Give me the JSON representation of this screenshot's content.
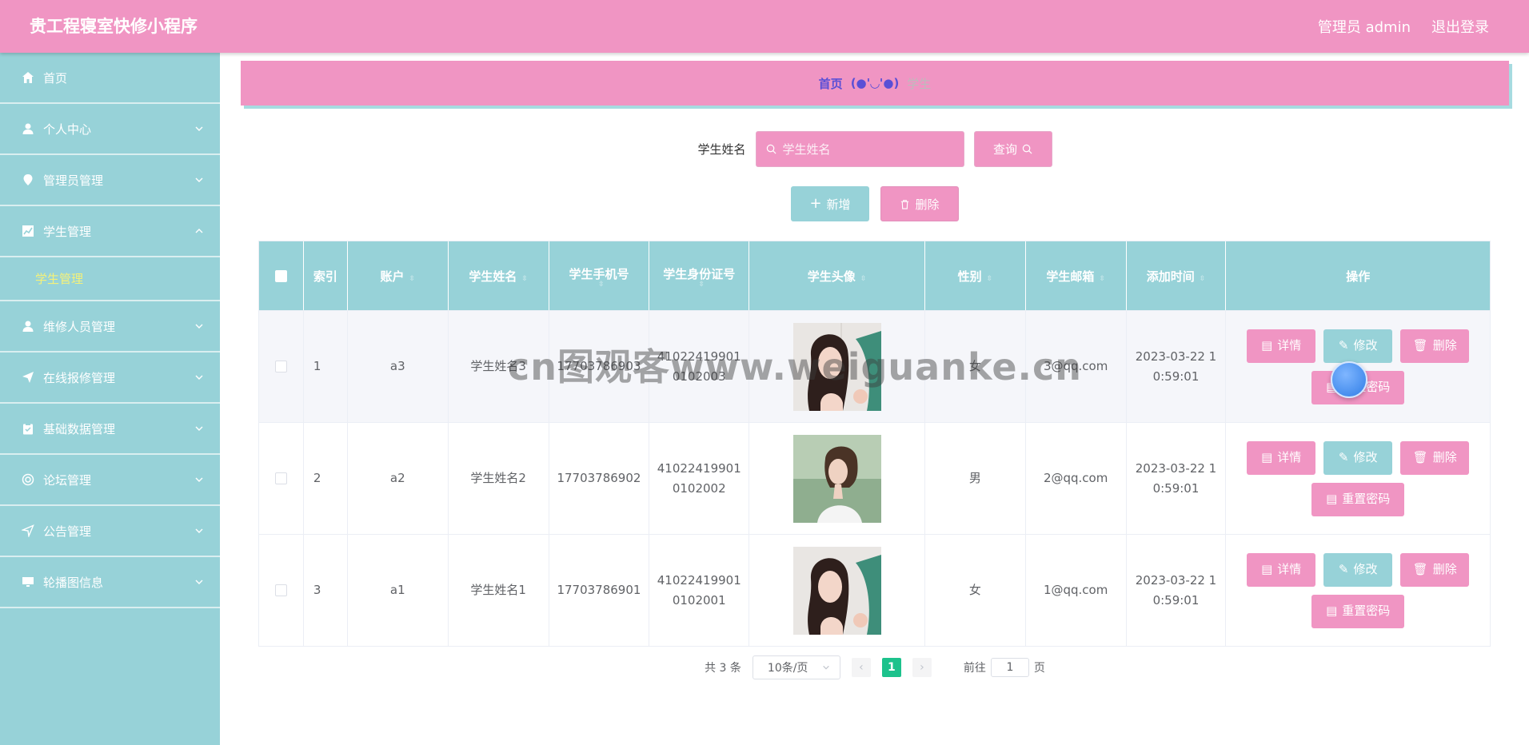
{
  "header": {
    "app_title": "贵工程寝室快修小程序",
    "user_label": "管理员 admin",
    "logout_label": "退出登录"
  },
  "sidebar": {
    "items": [
      {
        "label": "首页",
        "icon": "home-icon"
      },
      {
        "label": "个人中心",
        "icon": "user-icon"
      },
      {
        "label": "管理员管理",
        "icon": "location-pin-icon"
      },
      {
        "label": "学生管理",
        "icon": "chart-icon",
        "expanded": true,
        "children": [
          {
            "label": "学生管理"
          }
        ]
      },
      {
        "label": "维修人员管理",
        "icon": "user-icon"
      },
      {
        "label": "在线报修管理",
        "icon": "send-icon"
      },
      {
        "label": "基础数据管理",
        "icon": "clipboard-icon"
      },
      {
        "label": "论坛管理",
        "icon": "lifebuoy-icon"
      },
      {
        "label": "公告管理",
        "icon": "navigation-icon"
      },
      {
        "label": "轮播图信息",
        "icon": "monitor-icon"
      }
    ]
  },
  "breadcrumb": {
    "home": "首页",
    "separator": "(●'◡'●)",
    "current": "学生"
  },
  "search": {
    "label": "学生姓名",
    "placeholder": "学生姓名",
    "button": "查询"
  },
  "actions": {
    "add": "新增",
    "delete": "删除"
  },
  "table": {
    "columns": [
      "索引",
      "账户",
      "学生姓名",
      "学生手机号",
      "学生身份证号",
      "学生头像",
      "性别",
      "学生邮箱",
      "添加时间",
      "操作"
    ],
    "rows": [
      {
        "index": "1",
        "account": "a3",
        "name": "学生姓名3",
        "phone": "17703786903",
        "id_line1": "41022419901",
        "id_line2": "0102003",
        "sex": "女",
        "email": "3@qq.com",
        "time_line1": "2023-03-22 1",
        "time_line2": "0:59:01"
      },
      {
        "index": "2",
        "account": "a2",
        "name": "学生姓名2",
        "phone": "17703786902",
        "id_line1": "41022419901",
        "id_line2": "0102002",
        "sex": "男",
        "email": "2@qq.com",
        "time_line1": "2023-03-22 1",
        "time_line2": "0:59:01"
      },
      {
        "index": "3",
        "account": "a1",
        "name": "学生姓名1",
        "phone": "17703786901",
        "id_line1": "41022419901",
        "id_line2": "0102001",
        "sex": "女",
        "email": "1@qq.com",
        "time_line1": "2023-03-22 1",
        "time_line2": "0:59:01"
      }
    ],
    "op_labels": {
      "detail": "详情",
      "edit": "修改",
      "delete": "删除",
      "reset": "重置密码"
    }
  },
  "pagination": {
    "total": "共 3 条",
    "page_size": "10条/页",
    "current_page": "1",
    "goto_prefix": "前往",
    "goto_value": "1",
    "goto_suffix": "页"
  },
  "watermark": "cn图观客www.weiguanke.cn",
  "colors": {
    "header_pink": "#f095c3",
    "sidebar_teal": "#97d2d8",
    "active_sub": "#f4f17a",
    "page_active": "#1dc28c"
  }
}
